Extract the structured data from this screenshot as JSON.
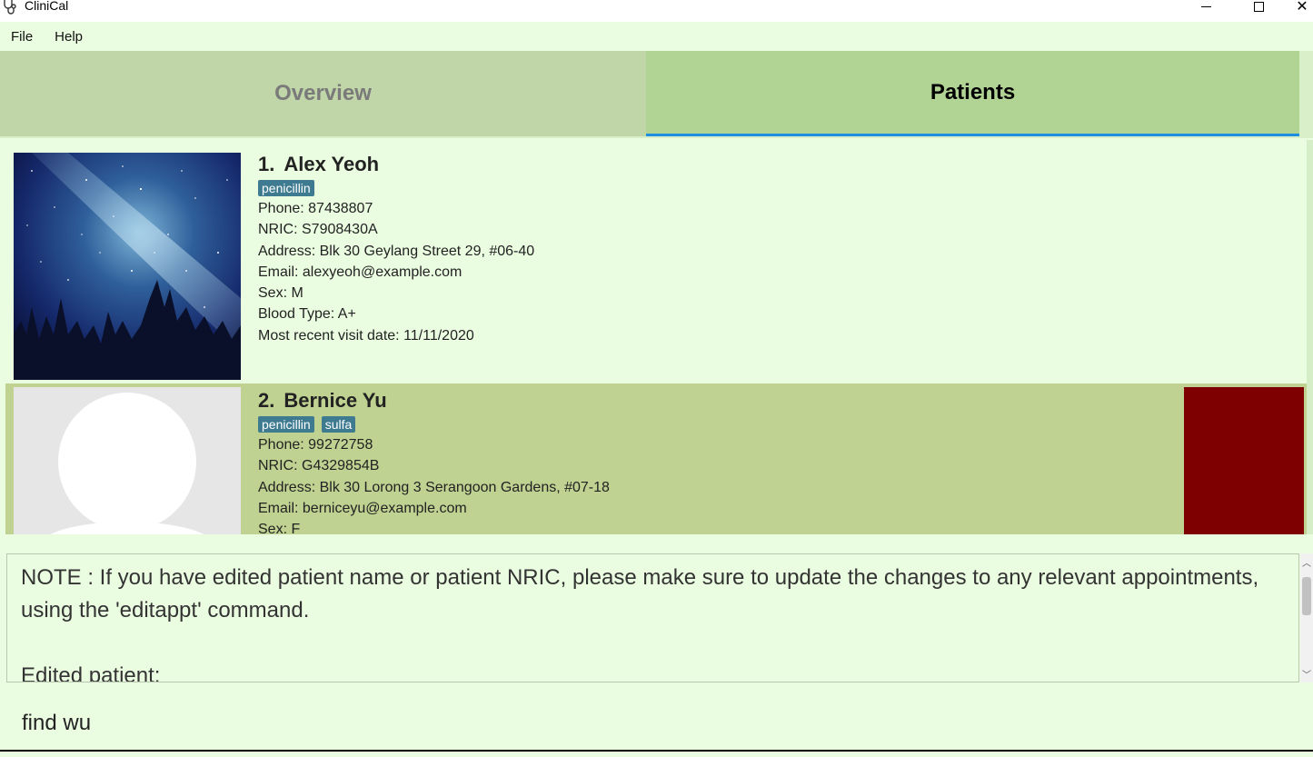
{
  "window": {
    "title": "CliniCal"
  },
  "menu": {
    "file": "File",
    "help": "Help"
  },
  "tabs": {
    "overview": "Overview",
    "patients": "Patients"
  },
  "patients": [
    {
      "index": "1.",
      "name": "Alex Yeoh",
      "tags": [
        "penicillin"
      ],
      "phone": "Phone: 87438807",
      "nric": "NRIC: S7908430A",
      "address": "Address: Blk 30 Geylang Street 29, #06-40",
      "email": "Email: alexyeoh@example.com",
      "sex": "Sex: M",
      "blood": "Blood Type: A+",
      "visit": "Most recent visit date: 11/11/2020"
    },
    {
      "index": "2.",
      "name": "Bernice Yu",
      "tags": [
        "penicillin",
        "sulfa"
      ],
      "phone": "Phone: 99272758",
      "nric": "NRIC: G4329854B",
      "address": "Address: Blk 30 Lorong 3 Serangoon Gardens, #07-18",
      "email": "Email: berniceyu@example.com",
      "sex": "Sex: F",
      "flag_color": "#7f0000"
    }
  ],
  "result": {
    "note": "NOTE : If you have edited patient name or patient NRIC, please make sure to update the changes to any relevant appointments, using the 'editappt' command.",
    "edited": "Edited patient:"
  },
  "command": {
    "value": "find wu"
  },
  "colors": {
    "background": "#ebfde1",
    "tab_active": "#b1d394",
    "tab_inactive": "#c1d6a8",
    "selected_card": "#bfd291",
    "tag": "#3e7b91",
    "tab_underline": "#1e8fe0"
  }
}
